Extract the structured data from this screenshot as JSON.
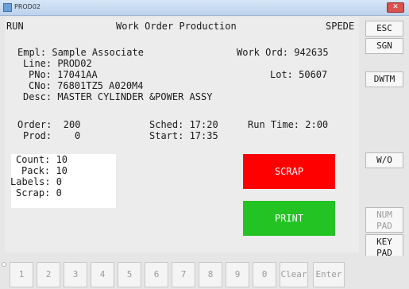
{
  "window": {
    "title": "PROD02",
    "close_glyph": "✕"
  },
  "header": {
    "mode": "RUN",
    "title": "Work Order Production",
    "system": "SPEDE"
  },
  "info": {
    "employee": "Empl: Sample Associate",
    "work_order": "Work Ord: 942635",
    "line": "Line: PROD02",
    "part_no": "PNo: 17041AA",
    "lot": "Lot: 50607",
    "cust_no": "CNo: 76801TZ5 A020M4",
    "description": "Desc: MASTER CYLINDER &POWER ASSY"
  },
  "production": {
    "order": "Order:  200",
    "prod": "Prod:    0",
    "sched": "Sched: 17:20",
    "start": "Start: 17:35",
    "run_time": "Run Time: 2:00"
  },
  "counts": {
    "count": "Count: 10",
    "pack": "Pack: 10",
    "labels": "Labels: 0",
    "scrap": "Scrap: 0"
  },
  "actions": {
    "scrap_label": "SCRAP",
    "print_label": "PRINT"
  },
  "side_buttons": {
    "esc": "ESC",
    "sgn": "SGN",
    "dwtm": "DWTM",
    "wo": "W/O",
    "num_pad": "NUM PAD",
    "key_pad": "KEY PAD"
  },
  "keypad": [
    "1",
    "2",
    "3",
    "4",
    "5",
    "6",
    "7",
    "8",
    "9",
    "0",
    "Clear",
    "Enter"
  ],
  "colors": {
    "scrap": "#ff0000",
    "print": "#22c322",
    "disabled_text": "#9a9a9a"
  }
}
